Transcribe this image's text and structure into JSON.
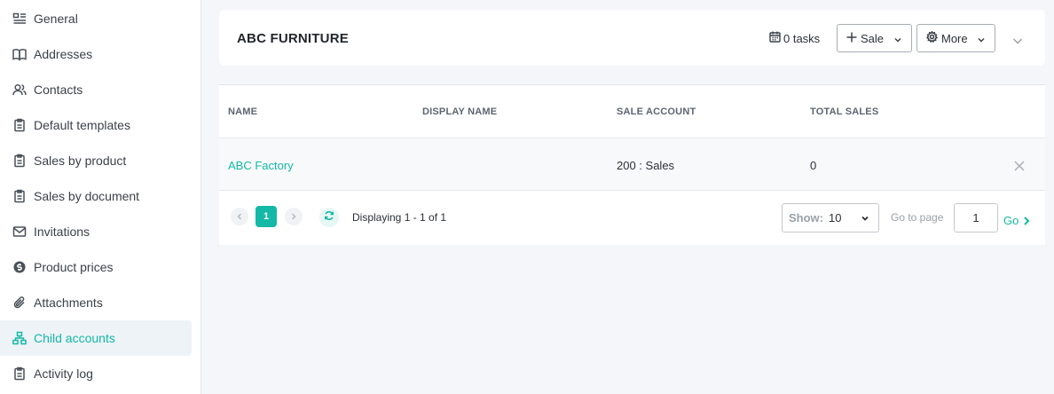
{
  "sidebar": {
    "items": [
      {
        "label": "General",
        "icon": "list-detail-icon"
      },
      {
        "label": "Addresses",
        "icon": "book-open-icon"
      },
      {
        "label": "Contacts",
        "icon": "users-icon"
      },
      {
        "label": "Default templates",
        "icon": "clipboard-icon"
      },
      {
        "label": "Sales by product",
        "icon": "clipboard-icon"
      },
      {
        "label": "Sales by document",
        "icon": "clipboard-icon"
      },
      {
        "label": "Invitations",
        "icon": "mail-icon"
      },
      {
        "label": "Product prices",
        "icon": "dollar-circle-icon"
      },
      {
        "label": "Attachments",
        "icon": "paperclip-icon"
      },
      {
        "label": "Child accounts",
        "icon": "hierarchy-icon",
        "active": true
      },
      {
        "label": "Activity log",
        "icon": "clipboard-icon"
      }
    ]
  },
  "header": {
    "title": "ABC FURNITURE",
    "tasks_label": "0 tasks",
    "sale_button": "Sale",
    "more_button": "More"
  },
  "table": {
    "columns": [
      "NAME",
      "DISPLAY NAME",
      "SALE ACCOUNT",
      "TOTAL SALES"
    ],
    "rows": [
      {
        "name": "ABC Factory",
        "display_name": "",
        "sale_account": "200 : Sales",
        "total_sales": "0"
      }
    ]
  },
  "pagination": {
    "current_page": "1",
    "display_text": "Displaying 1 - 1 of 1",
    "show_label": "Show:",
    "show_value": "10",
    "goto_label": "Go to page",
    "goto_value": "1",
    "go_label": "Go"
  },
  "colors": {
    "accent": "#14b8a6",
    "page_background": "#f4f6f9",
    "active_item_background": "#eef3f7"
  }
}
